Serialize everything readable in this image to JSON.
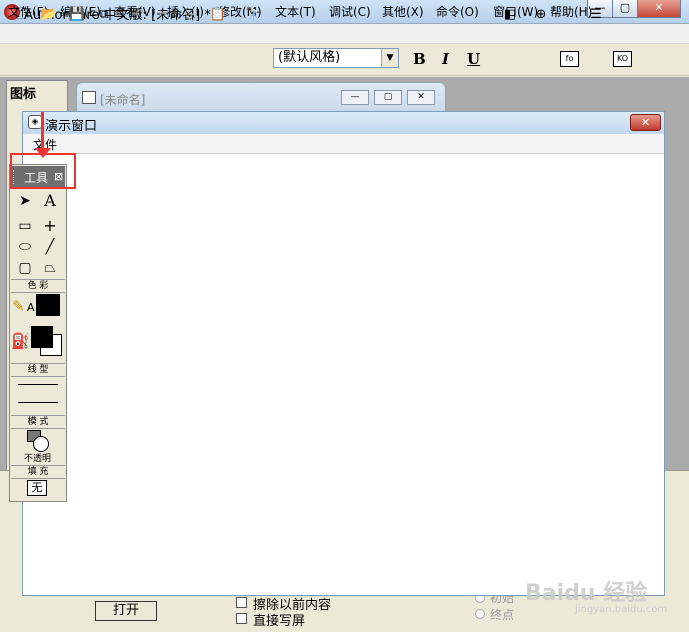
{
  "app": {
    "title": "Authorware 中文版: [未命名] *",
    "minimize": "—",
    "maximize": "▢",
    "close": "✕"
  },
  "menu": [
    "文件(F)",
    "编辑(E)",
    "查看(V)",
    "插入(I)",
    "修改(M)",
    "文本(T)",
    "调试(C)",
    "其他(X)",
    "命令(O)",
    "窗口(W)",
    "帮助(H)"
  ],
  "toolbar": {
    "style_select": "(默认风格)",
    "bold": "B",
    "italic": "I",
    "underline": "U",
    "fo": "fo",
    "ko": "KO"
  },
  "icon_panel": {
    "title": "图标"
  },
  "doc_window": {
    "title": "[未命名]"
  },
  "presentation": {
    "title": "演示窗口",
    "menu_file": "文件"
  },
  "tools": {
    "title": "工具",
    "close": "⊠",
    "sections": {
      "color": "色 彩",
      "line": "线 型",
      "mode": "模 式",
      "fill": "填 充"
    },
    "mode_value": "不透明",
    "fill_value": "无",
    "text_tool": "A",
    "pen_label": "A"
  },
  "bottom": {
    "open_button": "打开",
    "checkbox_erase": "擦除以前内容",
    "checkbox_direct": "直接写屏",
    "radio_start": "初始",
    "radio_end": "终点"
  },
  "watermark": {
    "text": "Baidu 经验",
    "sub": "jingyan.baidu.com"
  },
  "colors": {
    "highlight": "#e33333",
    "line_color": "#000000",
    "fill_fg": "#000000",
    "fill_bg": "#ffffff"
  }
}
